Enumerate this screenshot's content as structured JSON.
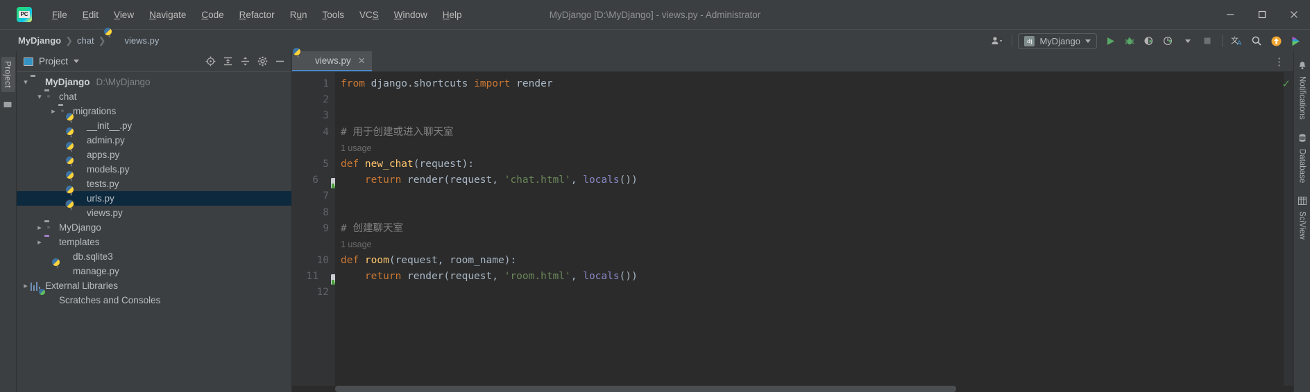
{
  "window": {
    "title": "MyDjango [D:\\MyDjango] - views.py - Administrator",
    "minimize_label": "—",
    "maximize_label": "☐",
    "close_label": "✕",
    "logo_name": "pycharm-logo"
  },
  "menubar": {
    "items": [
      {
        "label": "File",
        "mnemonic": "F",
        "rest": "ile"
      },
      {
        "label": "Edit",
        "mnemonic": "E",
        "rest": "dit"
      },
      {
        "label": "View",
        "mnemonic": "V",
        "rest": "iew"
      },
      {
        "label": "Navigate",
        "mnemonic": "N",
        "rest": "avigate"
      },
      {
        "label": "Code",
        "mnemonic": "C",
        "rest": "ode"
      },
      {
        "label": "Refactor",
        "mnemonic": "R",
        "rest": "efactor"
      },
      {
        "label": "Run",
        "mnemonic": "u",
        "pre": "R",
        "rest": "n"
      },
      {
        "label": "Tools",
        "mnemonic": "T",
        "rest": "ools"
      },
      {
        "label": "VCS",
        "mnemonic": "S",
        "pre": "VC",
        "rest": ""
      },
      {
        "label": "Window",
        "mnemonic": "W",
        "rest": "indow"
      },
      {
        "label": "Help",
        "mnemonic": "H",
        "rest": "elp"
      }
    ]
  },
  "navbar": {
    "breadcrumbs": [
      {
        "label": "MyDjango",
        "icon": "none"
      },
      {
        "label": "chat",
        "icon": "none"
      },
      {
        "label": "views.py",
        "icon": "python-file-icon"
      }
    ],
    "separator": "❯",
    "run_config": {
      "badge": "dj",
      "name": "MyDjango"
    },
    "icons": [
      "user-account-icon",
      "run-icon",
      "debug-icon",
      "run-with-coverage-icon",
      "profile-icon",
      "stop-icon",
      "translate-icon",
      "search-everywhere-icon",
      "update-project-icon",
      "ide-features-trainer-icon"
    ]
  },
  "left_strip": {
    "tab_label": "Project",
    "structure_icon": "structure-icon"
  },
  "project_panel": {
    "title": "Project",
    "actions": [
      "select-opened-file-icon",
      "expand-all-icon",
      "collapse-all-icon",
      "settings-icon",
      "hide-icon"
    ],
    "tree": [
      {
        "label": "MyDjango",
        "path": "D:\\MyDjango",
        "indent": 0,
        "arrow": "open",
        "icon": "folder-icon",
        "bold": true,
        "selected": false
      },
      {
        "label": "chat",
        "path": "",
        "indent": 1,
        "arrow": "open",
        "icon": "folder-source-icon",
        "bold": false,
        "selected": false
      },
      {
        "label": "migrations",
        "path": "",
        "indent": 2,
        "arrow": "closed",
        "icon": "folder-source-icon",
        "bold": false,
        "selected": false
      },
      {
        "label": "__init__.py",
        "path": "",
        "indent": 3,
        "arrow": "none",
        "icon": "python-file-icon",
        "bold": false,
        "selected": false
      },
      {
        "label": "admin.py",
        "path": "",
        "indent": 3,
        "arrow": "none",
        "icon": "python-file-icon",
        "bold": false,
        "selected": false
      },
      {
        "label": "apps.py",
        "path": "",
        "indent": 3,
        "arrow": "none",
        "icon": "python-file-icon",
        "bold": false,
        "selected": false
      },
      {
        "label": "models.py",
        "path": "",
        "indent": 3,
        "arrow": "none",
        "icon": "python-file-icon",
        "bold": false,
        "selected": false
      },
      {
        "label": "tests.py",
        "path": "",
        "indent": 3,
        "arrow": "none",
        "icon": "python-file-icon",
        "bold": false,
        "selected": false
      },
      {
        "label": "urls.py",
        "path": "",
        "indent": 3,
        "arrow": "none",
        "icon": "python-file-icon",
        "bold": false,
        "selected": true
      },
      {
        "label": "views.py",
        "path": "",
        "indent": 3,
        "arrow": "none",
        "icon": "python-file-icon",
        "bold": false,
        "selected": false
      },
      {
        "label": "MyDjango",
        "path": "",
        "indent": 1,
        "arrow": "closed",
        "icon": "folder-source-icon",
        "bold": false,
        "selected": false
      },
      {
        "label": "templates",
        "path": "",
        "indent": 1,
        "arrow": "closed",
        "icon": "folder-templates-icon",
        "bold": false,
        "selected": false
      },
      {
        "label": "db.sqlite3",
        "path": "",
        "indent": 2,
        "arrow": "none",
        "icon": "database-file-icon",
        "bold": false,
        "selected": false
      },
      {
        "label": "manage.py",
        "path": "",
        "indent": 2,
        "arrow": "none",
        "icon": "python-file-icon",
        "bold": false,
        "selected": false
      },
      {
        "label": "External Libraries",
        "path": "",
        "indent": 0,
        "arrow": "closed",
        "icon": "library-icon",
        "bold": false,
        "selected": false
      },
      {
        "label": "Scratches and Consoles",
        "path": "",
        "indent": 1,
        "arrow": "none",
        "icon": "scratches-icon",
        "bold": false,
        "selected": false
      }
    ]
  },
  "editor": {
    "tabs": [
      {
        "label": "views.py",
        "icon": "python-file-icon",
        "active": true,
        "close": "✕"
      }
    ],
    "kebab": "⋮",
    "inspection_status": "✓",
    "lines": [
      {
        "num": "1",
        "gutter": "",
        "fold": "",
        "tokens": [
          {
            "t": "from ",
            "c": "c-kw"
          },
          {
            "t": "django.shortcuts ",
            "c": "c-mod"
          },
          {
            "t": "import ",
            "c": "c-kw"
          },
          {
            "t": "render",
            "c": "c-mod"
          }
        ]
      },
      {
        "num": "2",
        "gutter": "",
        "fold": "",
        "tokens": []
      },
      {
        "num": "3",
        "gutter": "",
        "fold": "",
        "tokens": []
      },
      {
        "num": "4",
        "gutter": "",
        "fold": "",
        "tokens": [
          {
            "t": "# 用于创建或进入聊天室",
            "c": "c-comment"
          }
        ]
      },
      {
        "num": "",
        "gutter": "",
        "fold": "",
        "inlay": "1 usage",
        "tokens": []
      },
      {
        "num": "5",
        "gutter": "",
        "fold": "minus",
        "tokens": [
          {
            "t": "def ",
            "c": "c-kw"
          },
          {
            "t": "new_chat",
            "c": "c-fn"
          },
          {
            "t": "(request):",
            "c": "c-cls"
          }
        ]
      },
      {
        "num": "6",
        "gutter": "html",
        "fold": "end",
        "tokens": [
          {
            "t": "    return ",
            "c": "c-kw"
          },
          {
            "t": "render(request, ",
            "c": "c-cls"
          },
          {
            "t": "'chat.html'",
            "c": "c-str"
          },
          {
            "t": ", ",
            "c": "c-cls"
          },
          {
            "t": "locals",
            "c": "c-builtin"
          },
          {
            "t": "())",
            "c": "c-cls"
          }
        ]
      },
      {
        "num": "7",
        "gutter": "",
        "fold": "",
        "tokens": []
      },
      {
        "num": "8",
        "gutter": "",
        "fold": "",
        "tokens": []
      },
      {
        "num": "9",
        "gutter": "",
        "fold": "",
        "tokens": [
          {
            "t": "# 创建聊天室",
            "c": "c-comment"
          }
        ]
      },
      {
        "num": "",
        "gutter": "",
        "fold": "",
        "inlay": "1 usage",
        "tokens": []
      },
      {
        "num": "10",
        "gutter": "",
        "fold": "minus",
        "tokens": [
          {
            "t": "def ",
            "c": "c-kw"
          },
          {
            "t": "room",
            "c": "c-fn"
          },
          {
            "t": "(request, room_name):",
            "c": "c-cls"
          }
        ]
      },
      {
        "num": "11",
        "gutter": "html",
        "fold": "end",
        "tokens": [
          {
            "t": "    return ",
            "c": "c-kw"
          },
          {
            "t": "render(request, ",
            "c": "c-cls"
          },
          {
            "t": "'room.html'",
            "c": "c-str"
          },
          {
            "t": ", ",
            "c": "c-cls"
          },
          {
            "t": "locals",
            "c": "c-builtin"
          },
          {
            "t": "())",
            "c": "c-cls"
          }
        ]
      },
      {
        "num": "12",
        "gutter": "",
        "fold": "",
        "tokens": []
      }
    ]
  },
  "right_strip": {
    "tabs": [
      {
        "label": "Notifications",
        "icon": "bell-icon"
      },
      {
        "label": "Database",
        "icon": "database-icon"
      },
      {
        "label": "SciView",
        "icon": "grid-icon"
      }
    ]
  },
  "colors": {
    "accent": "#4a88c7",
    "selection": "#0d293e",
    "keyword": "#cc7832",
    "string": "#6a8759",
    "function": "#ffc66d",
    "comment": "#808080",
    "editor_bg": "#2b2b2b",
    "chrome_bg": "#3c3f41"
  }
}
